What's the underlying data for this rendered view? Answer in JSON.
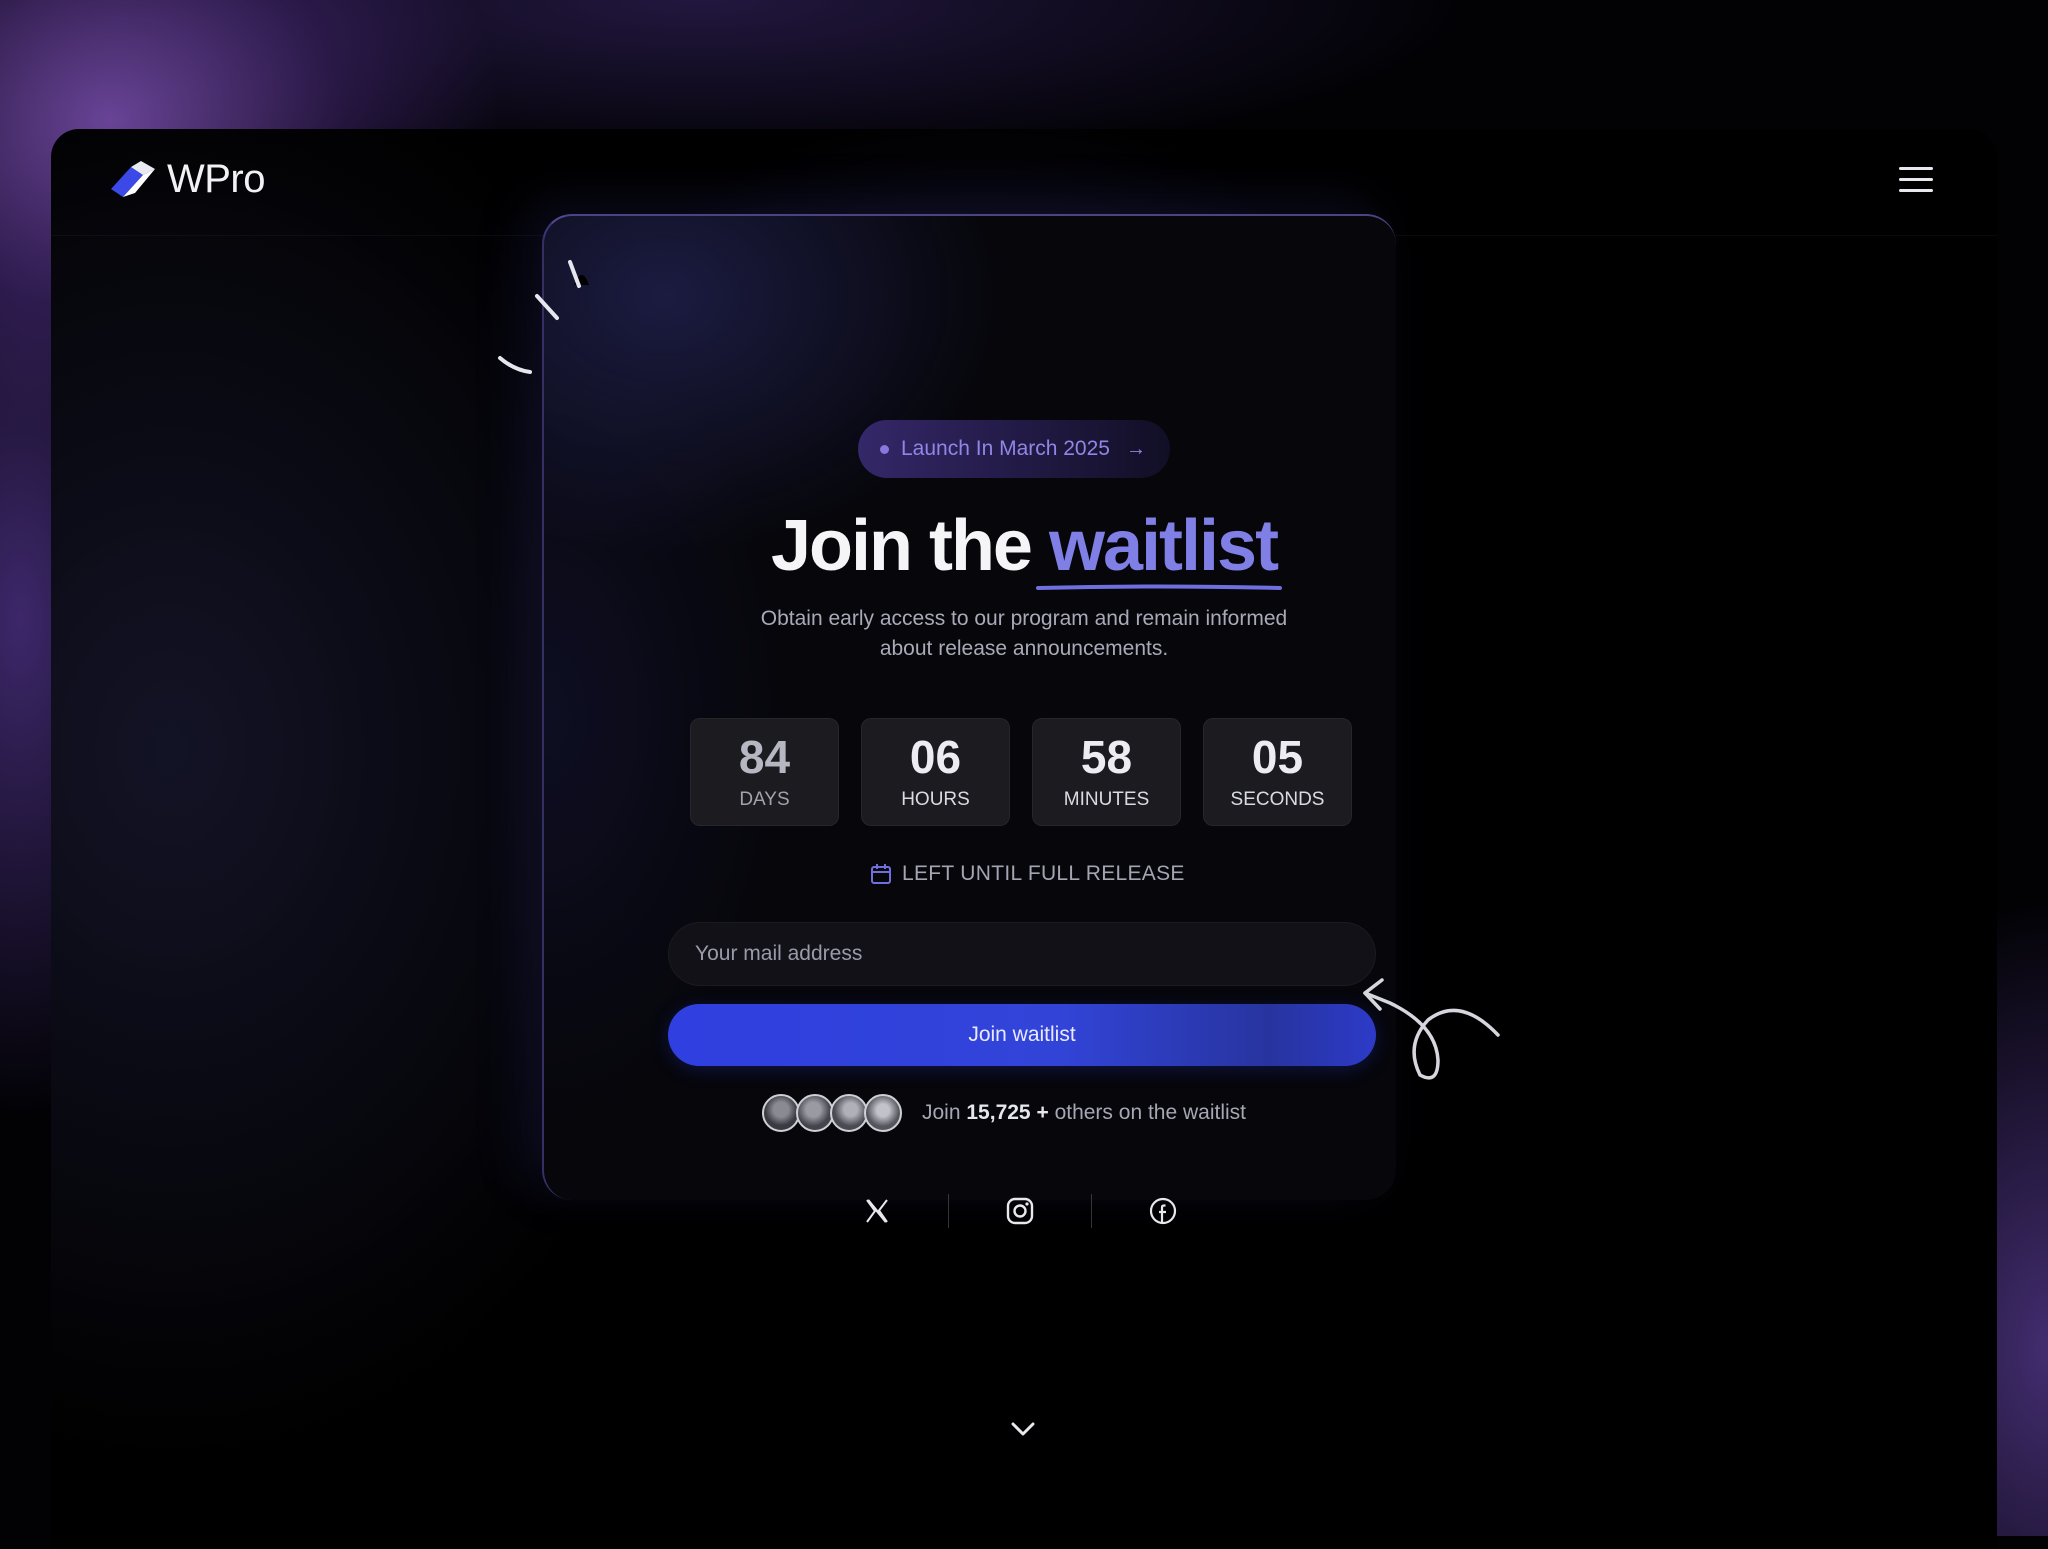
{
  "brand": {
    "name": "WPro",
    "logo_icon": "eraser-logo-icon"
  },
  "nav": {
    "menu_icon": "hamburger-menu-icon"
  },
  "badge": {
    "text": "Launch In March 2025",
    "arrow": "→"
  },
  "hero": {
    "title_prefix": "Join the",
    "title_accent": "waitlist",
    "subtitle": "Obtain early access to our program and remain informed about release announcements."
  },
  "countdown": [
    {
      "value": "84",
      "label": "DAYS"
    },
    {
      "value": "06",
      "label": "HOURS"
    },
    {
      "value": "58",
      "label": "MINUTES"
    },
    {
      "value": "05",
      "label": "SECONDS"
    }
  ],
  "release": {
    "icon": "calendar-icon",
    "text": "LEFT UNTIL FULL RELEASE"
  },
  "form": {
    "email_placeholder": "Your mail address",
    "email_value": "",
    "submit_label": "Join waitlist"
  },
  "social_proof": {
    "prefix": "Join",
    "count": "15,725 +",
    "suffix": "others on the waitlist",
    "avatar_count": 4
  },
  "socials": [
    {
      "name": "x-icon"
    },
    {
      "name": "instagram-icon"
    },
    {
      "name": "facebook-icon"
    }
  ],
  "colors": {
    "accent": "#7f7fe6",
    "button": "#3244d8",
    "background": "#000000"
  }
}
